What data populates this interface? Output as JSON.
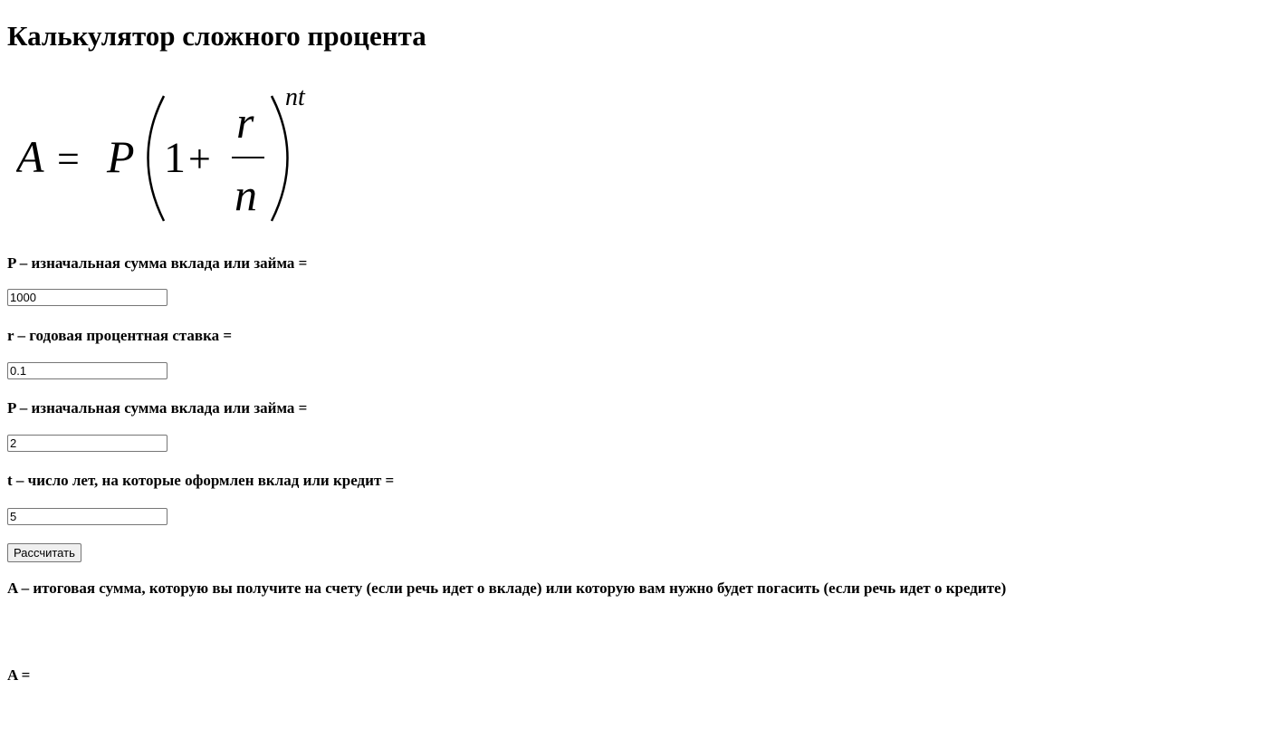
{
  "header": {
    "title": "Калькулятор сложного процента"
  },
  "formula": {
    "A": "A",
    "equals": "=",
    "P": "P",
    "one": "1",
    "plus": "+",
    "r": "r",
    "n": "n",
    "exponent": "nt"
  },
  "fields": [
    {
      "label": "P – изначальная сумма вклада или займа =",
      "value": "1000"
    },
    {
      "label": "r – годовая процентная ставка =",
      "value": "0.1"
    },
    {
      "label": "P – изначальная сумма вклада или займа =",
      "value": "2"
    },
    {
      "label": "t – число лет, на которые оформлен вклад или кредит =",
      "value": "5"
    }
  ],
  "actions": {
    "calculate_label": "Рассчитать"
  },
  "result": {
    "description": "A – итоговая сумма, которую вы получите на счету (если речь идет о вкладе) или которую вам нужно будет погасить (если речь идет о кредите)",
    "label": "A =",
    "value": ""
  }
}
